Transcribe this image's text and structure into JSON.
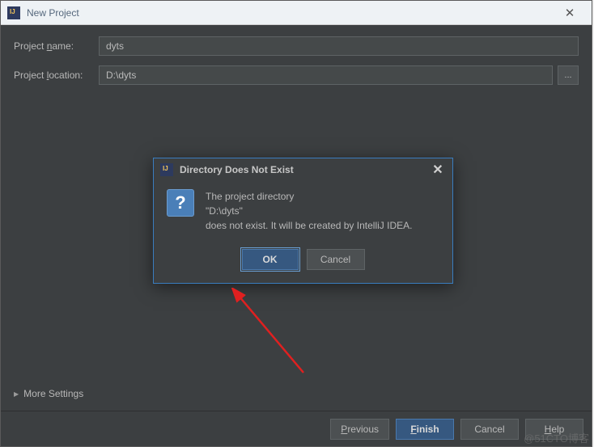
{
  "window": {
    "title": "New Project",
    "close_glyph": "✕"
  },
  "form": {
    "name_label_pre": "Project ",
    "name_label_u": "n",
    "name_label_post": "ame:",
    "name_value": "dyts",
    "loc_label_pre": "Project ",
    "loc_label_u": "l",
    "loc_label_post": "ocation:",
    "loc_value": "D:\\dyts",
    "browse_label": "...",
    "more_settings_label": "More Settings"
  },
  "footer": {
    "previous_u": "P",
    "previous_post": "revious",
    "finish_u": "F",
    "finish_post": "inish",
    "cancel": "Cancel",
    "help_pre": "",
    "help_u": "H",
    "help_post": "elp"
  },
  "modal": {
    "title": "Directory Does Not Exist",
    "close_glyph": "✕",
    "icon_glyph": "?",
    "line1": "The project directory",
    "line2": "\"D:\\dyts\"",
    "line3": "does not exist. It will be created by IntelliJ IDEA.",
    "ok": "OK",
    "cancel": "Cancel"
  },
  "annotation": {
    "watermark": "@51CTO博客"
  }
}
